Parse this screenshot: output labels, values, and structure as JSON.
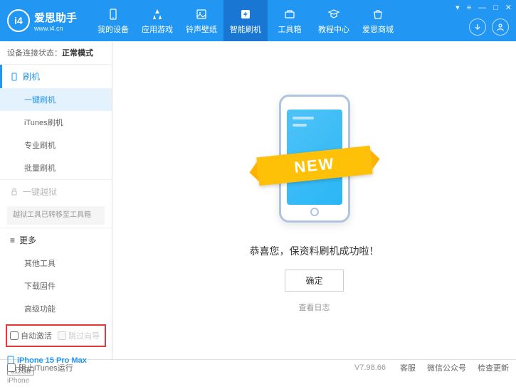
{
  "logo": {
    "title": "爱思助手",
    "subtitle": "www.i4.cn",
    "mark": "i4"
  },
  "nav": [
    {
      "label": "我的设备"
    },
    {
      "label": "应用游戏"
    },
    {
      "label": "铃声壁纸"
    },
    {
      "label": "智能刷机"
    },
    {
      "label": "工具箱"
    },
    {
      "label": "教程中心"
    },
    {
      "label": "爱思商城"
    }
  ],
  "status": {
    "label": "设备连接状态：",
    "value": "正常模式"
  },
  "sidebar": {
    "flash": {
      "head": "刷机",
      "items": [
        "一键刷机",
        "iTunes刷机",
        "专业刷机",
        "批量刷机"
      ]
    },
    "jailbreak": {
      "head": "一键越狱",
      "note": "越狱工具已转移至工具箱"
    },
    "more": {
      "head": "更多",
      "items": [
        "其他工具",
        "下载固件",
        "高级功能"
      ]
    }
  },
  "checks": {
    "auto": "自动激活",
    "skip": "跳过向导"
  },
  "device": {
    "name": "iPhone 15 Pro Max",
    "storage": "512GB",
    "type": "iPhone"
  },
  "main": {
    "ribbon": "NEW",
    "message": "恭喜您，保资料刷机成功啦！",
    "ok": "确定",
    "log": "查看日志"
  },
  "footer": {
    "itunes": "阻止iTunes运行",
    "version": "V7.98.66",
    "links": [
      "客服",
      "微信公众号",
      "检查更新"
    ]
  }
}
